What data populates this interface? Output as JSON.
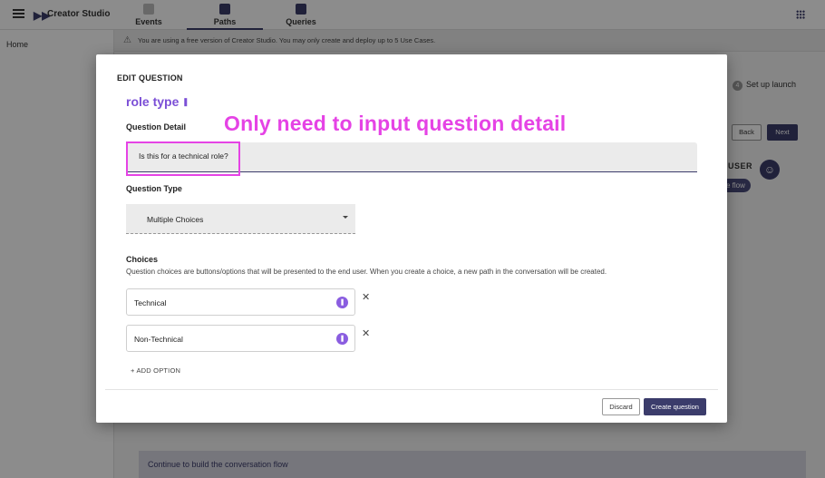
{
  "app": {
    "brand_name": "Creator Studio",
    "nav_tabs": [
      {
        "label": "Events",
        "active": false
      },
      {
        "label": "Paths",
        "active": true
      },
      {
        "label": "Queries",
        "active": false
      }
    ],
    "sidebar_home": "Home",
    "banner_text": "You are using a free version of Creator Studio. You may only create and deploy up to 5 Use Cases.",
    "banner_icon": "warning-icon",
    "step": {
      "number": "4",
      "label": "Set up launch"
    },
    "back_label": "Back",
    "next_label": "Next",
    "user_label": "USER",
    "flow_chip": "e flow",
    "continue_text": "Continue to build the conversation flow",
    "accent_color": "#3b3c6b"
  },
  "modal": {
    "title": "EDIT QUESTION",
    "question_name": "role type",
    "annotation": "Only need to input question detail",
    "annotation_color": "#e543e5",
    "question_detail_label": "Question Detail",
    "question_detail_value": "Is this for a technical role?",
    "question_type_label": "Question Type",
    "question_type_value": "Multiple Choices",
    "choices_label": "Choices",
    "choices_description": "Question choices are buttons/options that will be presented to the end user. When you create a choice, a new path in the conversation will be created.",
    "choices": [
      {
        "label": "Technical"
      },
      {
        "label": "Non-Technical"
      }
    ],
    "add_option_label": "+ ADD OPTION",
    "discard_label": "Discard",
    "create_label": "Create question"
  }
}
